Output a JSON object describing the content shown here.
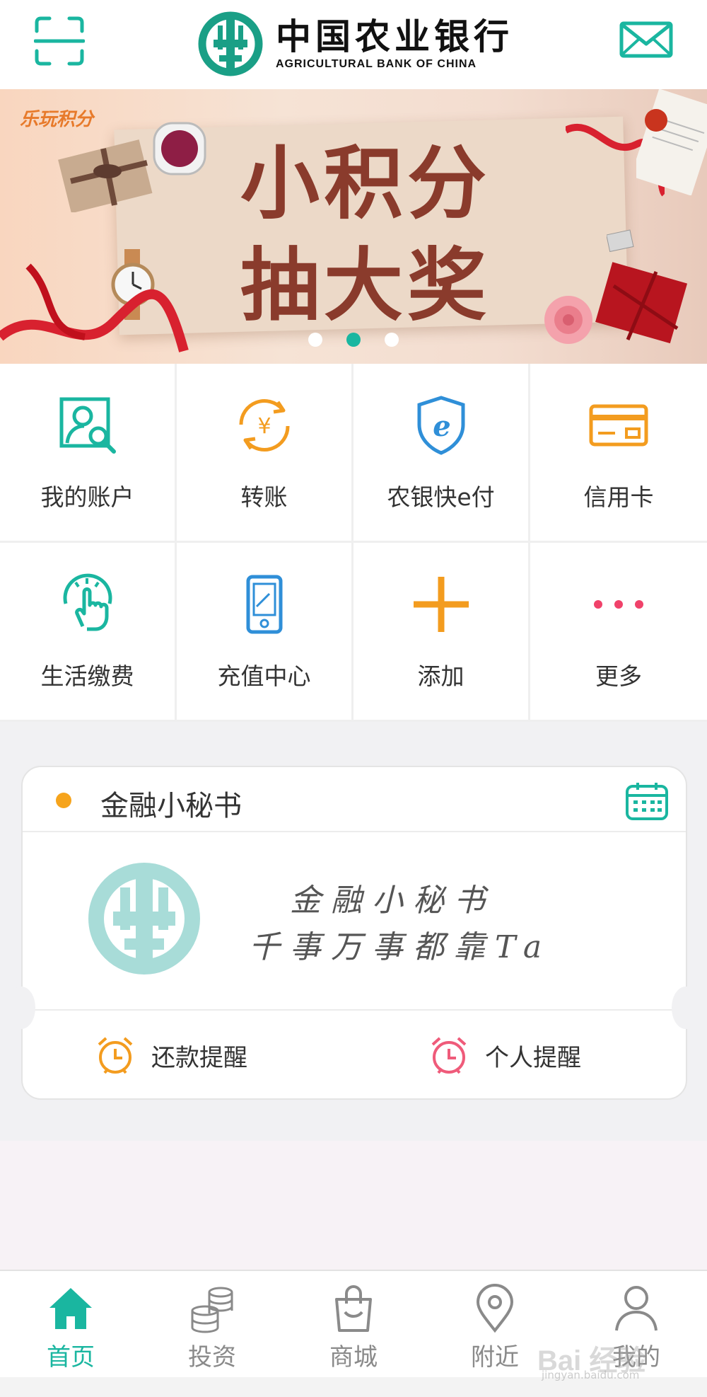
{
  "header": {
    "brand_cn": "中国农业银行",
    "brand_en": "AGRICULTURAL BANK OF CHINA",
    "scan_icon": "scan-icon",
    "mail_icon": "mail-icon",
    "accent": "#1ab6a0"
  },
  "banner": {
    "tag": "乐玩积分",
    "line1": "小积分",
    "line2": "抽大奖",
    "dots": 3,
    "active_dot": 2
  },
  "grid": {
    "items": [
      {
        "label": "我的账户",
        "icon": "account-search-icon"
      },
      {
        "label": "转账",
        "icon": "transfer-yuan-icon"
      },
      {
        "label": "农银快e付",
        "icon": "e-pay-shield-icon"
      },
      {
        "label": "信用卡",
        "icon": "credit-card-icon"
      },
      {
        "label": "生活缴费",
        "icon": "tap-finger-icon"
      },
      {
        "label": "充值中心",
        "icon": "mobile-phone-icon"
      },
      {
        "label": "添加",
        "icon": "plus-icon"
      },
      {
        "label": "更多",
        "icon": "more-dots-icon"
      }
    ]
  },
  "secretary": {
    "title": "金融小秘书",
    "slogan1": "金融小秘书",
    "slogan2": "千事万事都靠Ta",
    "repay_reminder": "还款提醒",
    "personal_reminder": "个人提醒"
  },
  "tabbar": {
    "tabs": [
      {
        "label": "首页",
        "icon": "home-icon"
      },
      {
        "label": "投资",
        "icon": "coins-icon"
      },
      {
        "label": "商城",
        "icon": "shopping-bag-icon"
      },
      {
        "label": "附近",
        "icon": "location-pin-icon"
      },
      {
        "label": "我的",
        "icon": "user-icon"
      }
    ]
  },
  "watermark": {
    "main": "Bai 经验",
    "sub": "jingyan.baidu.com"
  }
}
